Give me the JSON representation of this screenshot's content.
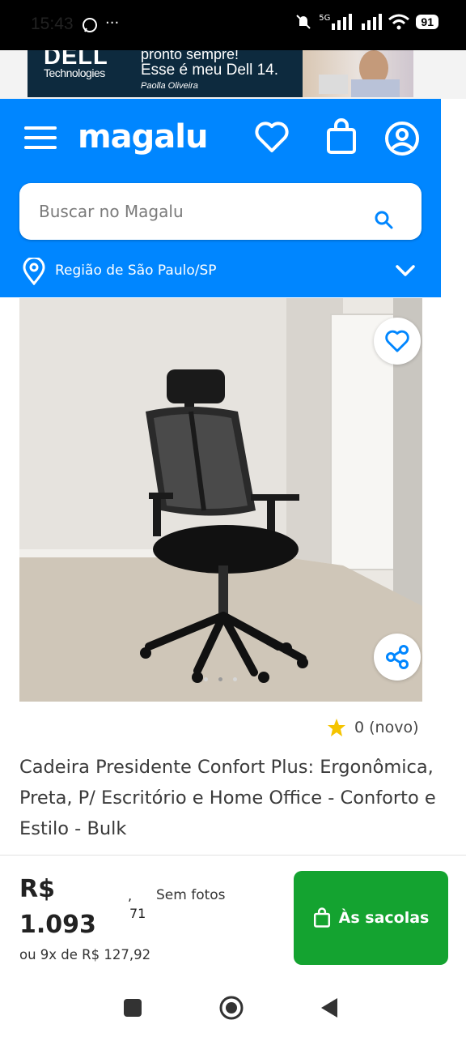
{
  "status_bar": {
    "time": "15:43",
    "battery": "91",
    "network": "5G"
  },
  "ad": {
    "brand": "DELL",
    "brand_sub": "Technologies",
    "line1": "pronto sempre!",
    "line2": "Esse é meu Dell 14.",
    "line3": "Paolla Oliveira"
  },
  "header": {
    "logo": "magalu",
    "search_placeholder": "Buscar no Magalu",
    "region": "Região de São Paulo/SP"
  },
  "product": {
    "rating_text": "0 (novo)",
    "title": "Cadeira Presidente Confort Plus: Ergonômica, Preta, P/ Escritório e Home Office - Conforto e Estilo - Bulk"
  },
  "buy_bar": {
    "currency": "R$",
    "price_int": "1.093",
    "price_comma": ",",
    "price_cents": "71",
    "no_photos": "Sem fotos",
    "installments": "ou 9x de R$ 127,92",
    "add_to_bag": "Às sacolas"
  },
  "colors": {
    "header_blue": "#0086ff",
    "buy_green": "#14a330",
    "star": "#f5c400"
  }
}
